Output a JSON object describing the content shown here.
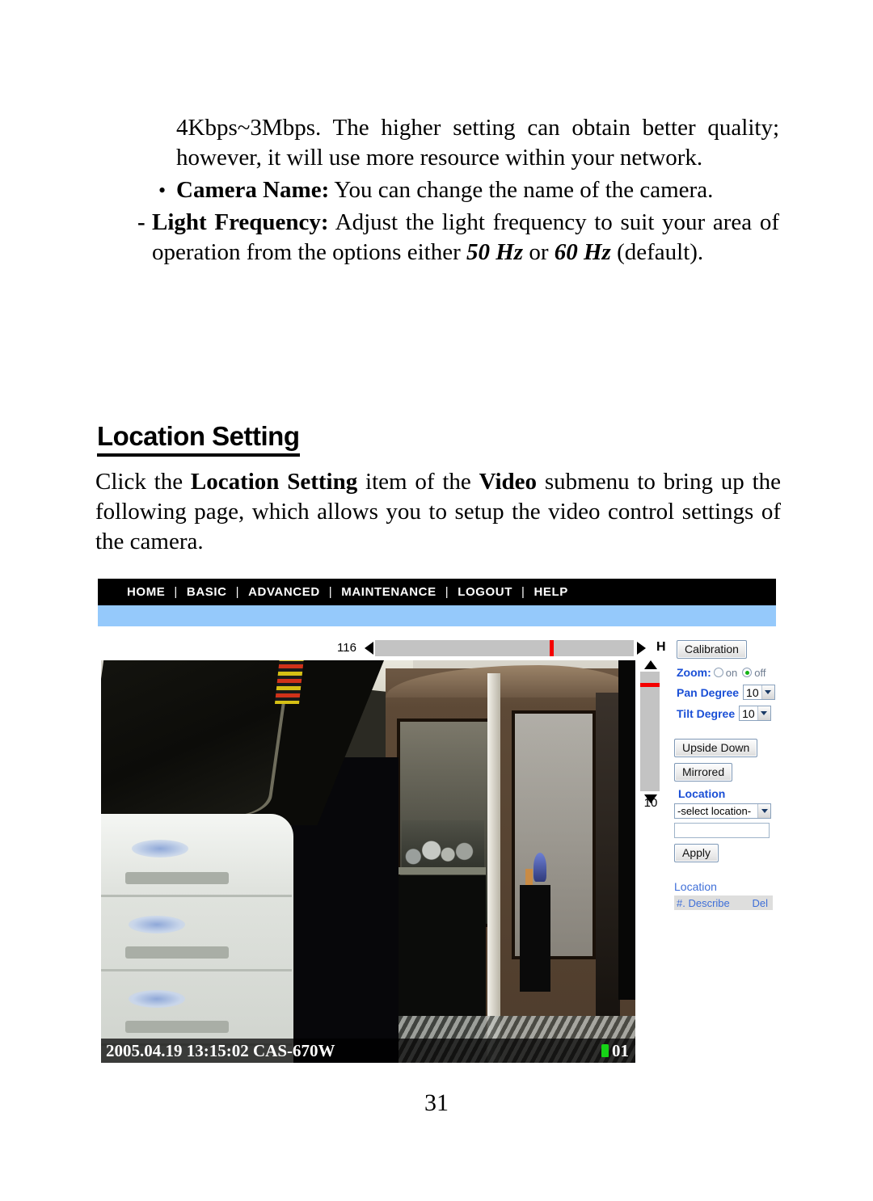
{
  "document": {
    "para1_parts": {
      "text": "4Kbps~3Mbps.  The higher setting can obtain better quality; however, it will use more resource within your network."
    },
    "bullet": {
      "marker": "•",
      "term": "Camera Name:",
      "rest": " You can change the name of the camera."
    },
    "dash": {
      "marker": "-",
      "term": "Light Frequency:",
      "rest_a": " Adjust the light frequency to suit your area of operation from the options either ",
      "em1": "50 Hz",
      "mid": " or ",
      "em2": "60 Hz",
      "rest_b": " (default)."
    },
    "heading": "Location Setting",
    "intro": {
      "a": "Click the ",
      "b1": "Location Setting",
      "c": " item of the ",
      "b2": "Video",
      "d": " submenu to bring up the following page, which allows you to setup the video control settings of the camera."
    },
    "page_number": "31"
  },
  "camera_ui": {
    "nav": {
      "items": [
        "HOME",
        "BASIC",
        "ADVANCED",
        "MAINTENANCE",
        "LOGOUT",
        "HELP"
      ],
      "separator": "|"
    },
    "horizontal_slider": {
      "value": "116",
      "left_arrow": "◀",
      "right_arrow": "▶",
      "axis_letter": "H"
    },
    "vertical_slider": {
      "value": "10",
      "up_arrow": "▲",
      "down_arrow": "▼"
    },
    "controls": {
      "calibration_label": "Calibration",
      "zoom_label": "Zoom:",
      "zoom_on_label": "on",
      "zoom_off_label": "off",
      "zoom_selected": "off",
      "pan_degree_label": "Pan Degree",
      "pan_degree_value": "10",
      "tilt_degree_label": "Tilt Degree",
      "tilt_degree_value": "10",
      "upside_down_label": "Upside Down",
      "mirrored_label": "Mirrored",
      "location_label": "Location",
      "location_select_value": "-select location-",
      "location_input_value": "",
      "location_input_placeholder": "",
      "apply_label": "Apply",
      "location_list_title": "Location",
      "location_list_col_describe": "#. Describe",
      "location_list_col_del": "Del"
    },
    "video": {
      "timestamp": "2005.04.19 13:15:02 CAS-670W",
      "channel": "01"
    },
    "colors": {
      "nav_background": "#000000",
      "sub_nav_background": "#95c9fb",
      "label_blue": "#1a4fd6",
      "link_blue": "#3f6fd8",
      "slider_track": "#c3c3c3",
      "slider_marker": "#f40000",
      "radio_selected": "#13b313",
      "list_header_background": "#dededd"
    }
  }
}
